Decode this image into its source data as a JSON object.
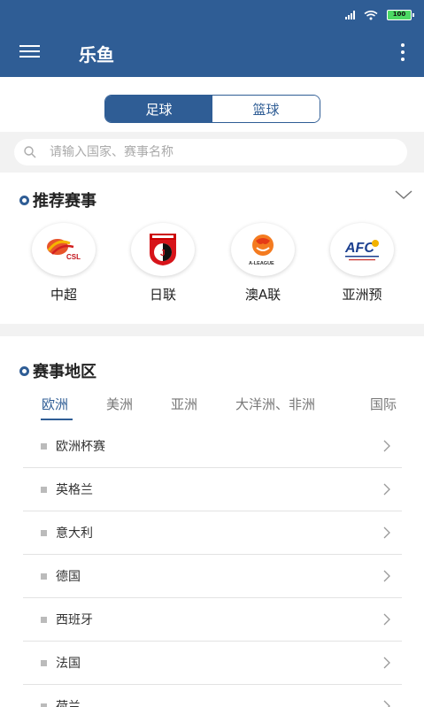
{
  "status_bar": {
    "battery": "100"
  },
  "app_bar": {
    "title": "乐鱼"
  },
  "sport_toggle": {
    "options": [
      "足球",
      "篮球"
    ],
    "selected": "足球"
  },
  "search": {
    "placeholder": "请输入国家、赛事名称"
  },
  "recommended": {
    "title": "推荐赛事",
    "leagues": [
      {
        "name": "中超",
        "logo_text": "CSL"
      },
      {
        "name": "日联",
        "logo_text": "J"
      },
      {
        "name": "澳A联",
        "logo_text": "A-LEAGUE"
      },
      {
        "name": "亚洲预",
        "logo_text": "AFC"
      }
    ]
  },
  "regions": {
    "title": "赛事地区",
    "tabs": [
      "欧洲",
      "美洲",
      "亚洲",
      "大洋洲、非洲",
      "国际"
    ],
    "active_tab": "欧洲",
    "items": [
      "欧洲杯赛",
      "英格兰",
      "意大利",
      "德国",
      "西班牙",
      "法国",
      "荷兰"
    ]
  },
  "colors": {
    "primary": "#2f5d95",
    "band": "#f2f2f2"
  }
}
